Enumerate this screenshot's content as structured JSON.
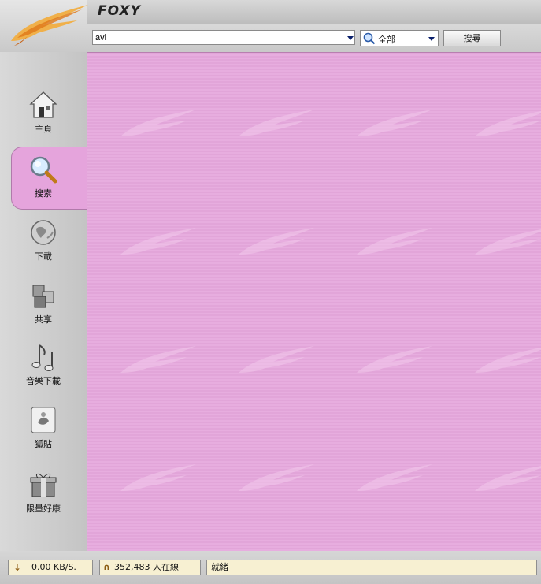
{
  "app": {
    "brand": "FOXY"
  },
  "search": {
    "query": "avi",
    "scope_label": "全部",
    "button_label": "搜尋"
  },
  "sidebar": {
    "items": [
      {
        "label": "主頁",
        "icon": "home-icon"
      },
      {
        "label": "搜索",
        "icon": "magnifier-icon",
        "active": true
      },
      {
        "label": "下載",
        "icon": "globe-icon"
      },
      {
        "label": "共享",
        "icon": "cubes-icon"
      },
      {
        "label": "音樂下載",
        "icon": "music-notes-icon"
      },
      {
        "label": "狐貼",
        "icon": "note-icon"
      },
      {
        "label": "限量好康",
        "icon": "gift-icon"
      }
    ]
  },
  "status": {
    "speed": "0.00 KB/S.",
    "online": "352,483 人在線",
    "state": "就緒"
  },
  "colors": {
    "main_bg": "#e6a8dd",
    "accent": "#0a1f6b",
    "status_panel": "#f7f0d2"
  }
}
